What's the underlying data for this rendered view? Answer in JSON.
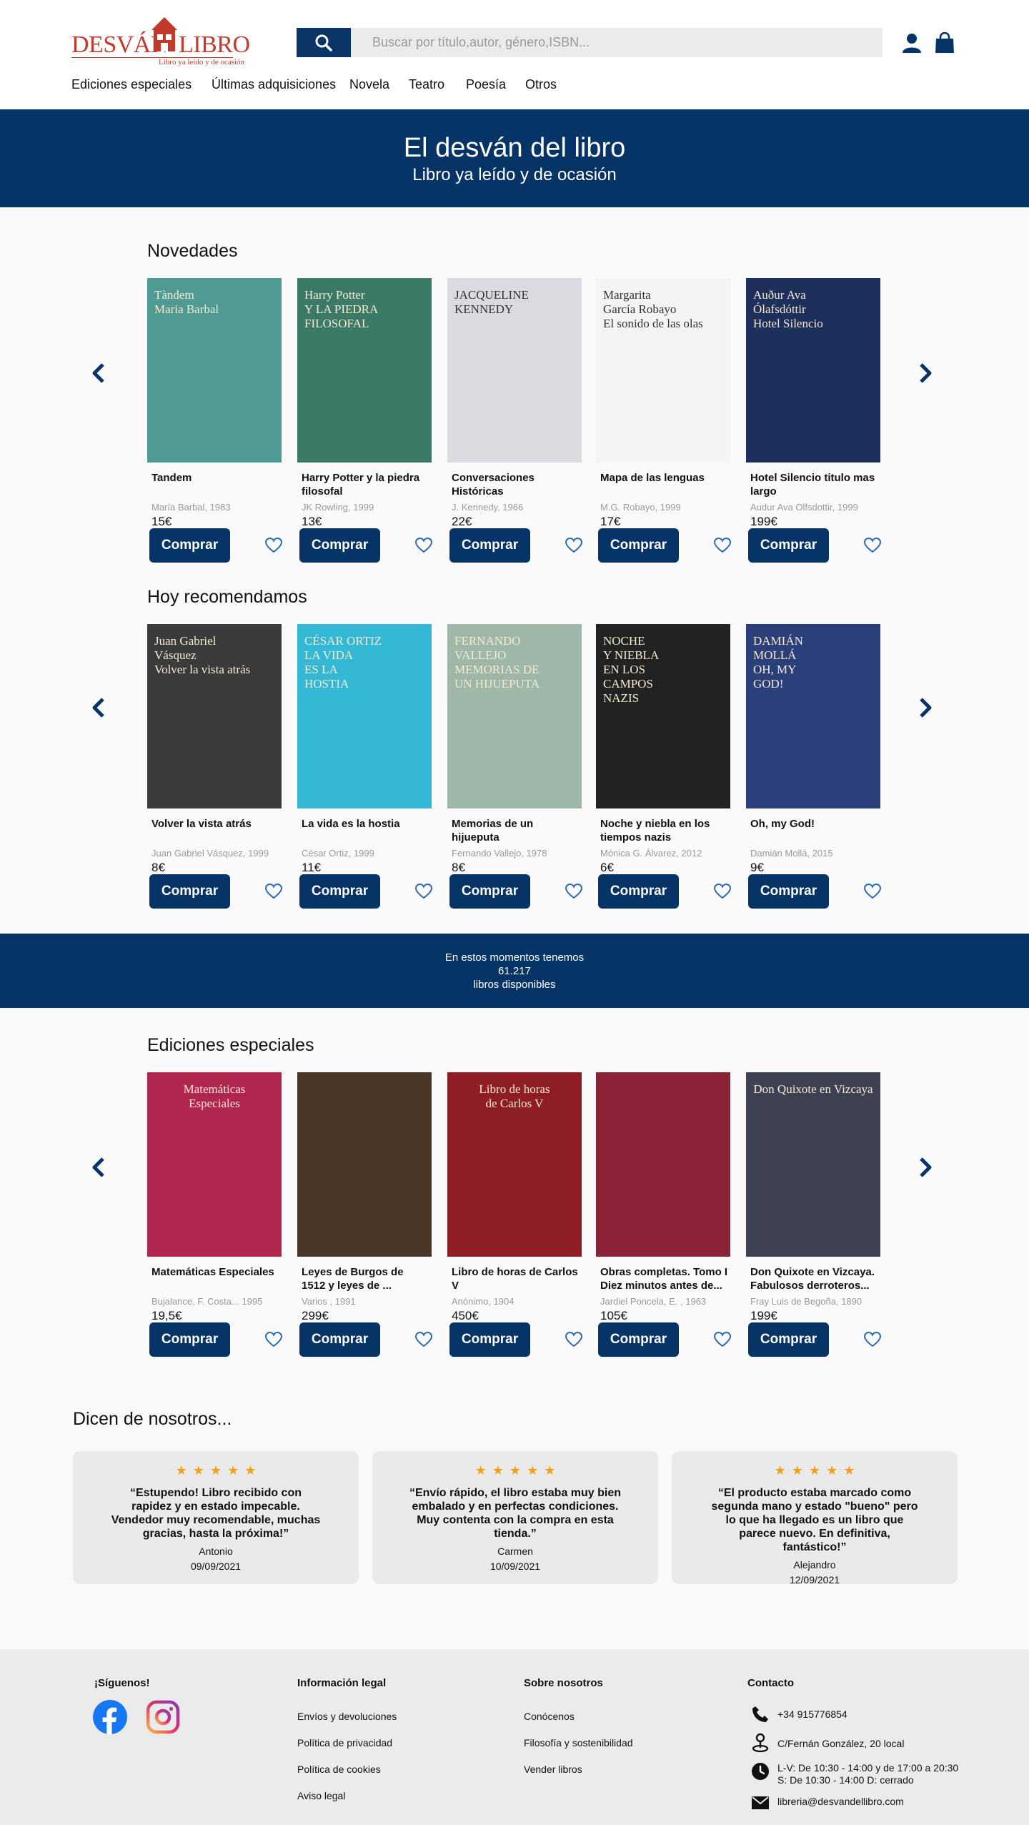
{
  "brand": {
    "name_left": "DESVÁN",
    "name_right": "LIBRO",
    "tagline": "Libro ya leído y de ocasión",
    "primary_color": "#073467",
    "logo_color": "#c23a2b"
  },
  "search": {
    "placeholder": "Buscar por título,autor, género,ISBN...",
    "value": ""
  },
  "nav": [
    "Ediciones especiales",
    "Últimas adquisiciones",
    "Novela",
    "Teatro",
    "Poesía",
    "Otros"
  ],
  "hero": {
    "title": "El desván del libro",
    "subtitle": "Libro ya leído y de ocasión"
  },
  "buy_label": "Comprar",
  "sections": [
    {
      "title": "Novedades",
      "books": [
        {
          "title": "Tandem",
          "meta": "María Barbal, 1983",
          "price": "15€",
          "cover_text": "Tàndem\nMaria Barbal",
          "cover_color": "#4f9a93"
        },
        {
          "title": "Harry Potter y la piedra filosofal",
          "meta": "JK Rowling, 1999",
          "price": "13€",
          "cover_text": "Harry Potter\nY LA PIEDRA FILOSOFAL",
          "cover_color": "#3a7a66"
        },
        {
          "title": "Conversaciones Históricas",
          "meta": "J. Kennedy, 1966",
          "price": "22€",
          "cover_text": "JACQUELINE\nKENNEDY",
          "cover_color": "#d9dbe0"
        },
        {
          "title": "Mapa de las lenguas",
          "meta": "M.G. Robayo, 1999",
          "price": "17€",
          "cover_text": "Margarita\nGarcía Robayo\nEl sonido de las olas",
          "cover_color": "#f4f4f2"
        },
        {
          "title": "Hotel Silencio titulo mas largo",
          "meta": "Audur Ava Olfsdottir, 1999",
          "price": "199€",
          "cover_text": "Auður Ava\nÓlafsdóttir\nHotel Silencio",
          "cover_color": "#1d2f5a"
        }
      ]
    },
    {
      "title": "Hoy recomendamos",
      "books": [
        {
          "title": "Volver la vista atrás",
          "meta": "Juan Gabriel Vásquez, 1999",
          "price": "8€",
          "cover_text": "Juan Gabriel\nVásquez\nVolver la vista atrás",
          "cover_color": "#3b3b3b"
        },
        {
          "title": "La vida es la hostia",
          "meta": "César Ortiz, 1999",
          "price": "11€",
          "cover_text": "CÉSAR ORTIZ\nLA VIDA\nES LA\nHOSTIA",
          "cover_color": "#33b9d6"
        },
        {
          "title": "Memorias de un hijueputa",
          "meta": "Fernando Vallejo, 1978",
          "price": "8€",
          "cover_text": "FERNANDO\nVALLEJO\nMEMORIAS DE\nUN HIJUEPUTA",
          "cover_color": "#9fb7a8"
        },
        {
          "title": "Noche y niebla en los tiempos nazis",
          "meta": "Mónica G. Álvarez, 2012",
          "price": "6€",
          "cover_text": "NOCHE\nY NIEBLA\nEN LOS\nCAMPOS\nNAZIS",
          "cover_color": "#222222"
        },
        {
          "title": "Oh, my God!",
          "meta": "Damián Mollá, 2015",
          "price": "9€",
          "cover_text": "DAMIÁN\nMOLLÁ\nOH, MY\nGOD!",
          "cover_color": "#2b3f7a"
        }
      ]
    },
    {
      "title": "Ediciones especiales",
      "books": [
        {
          "title": "Matemáticas Especiales",
          "meta": "Bujalance, F. Costa... 1995",
          "price": "19,5€",
          "cover_text": "Matemáticas\nEspeciales",
          "cover_color": "#b1264f"
        },
        {
          "title": "Leyes de Burgos de 1512 y leyes de ...",
          "meta": "Varios , 1991",
          "price": "299€",
          "cover_text": "",
          "cover_color": "#4a3626"
        },
        {
          "title": "Libro de horas de Carlos V",
          "meta": "Anónimo, 1904",
          "price": "450€",
          "cover_text": "Libro de horas\nde Carlos V",
          "cover_color": "#8e1d25"
        },
        {
          "title": "Obras completas. Tomo I Diez minutos antes de...",
          "meta": "Jardiel Poncela, E. , 1963",
          "price": "105€",
          "cover_text": "",
          "cover_color": "#8a2238"
        },
        {
          "title": "Don Quixote en Vizcaya. Fabulosos derroteros...",
          "meta": "Fray Luis de Begoña, 1890",
          "price": "199€",
          "cover_text": "Don Quixote en Vizcaya",
          "cover_color": "#3e4152"
        }
      ]
    }
  ],
  "stats": {
    "line1": "En estos momentos tenemos",
    "count": "61.217",
    "line2": "libros disponibles"
  },
  "reviews_title": "Dicen de nosotros...",
  "reviews": [
    {
      "stars": "★★★★★",
      "rating": 5,
      "quote": "“Estupendo! Libro recibido con rapidez y en estado impecable. Vendedor muy recomendable, muchas gracias, hasta la próxima!”",
      "author": "Antonio",
      "date": "09/09/2021"
    },
    {
      "stars": "★★★★★",
      "rating": 5,
      "quote": "“Envío rápido, el libro estaba muy bien embalado y en perfectas condiciones. Muy contenta con la compra en esta tienda.”",
      "author": "Carmen",
      "date": "10/09/2021"
    },
    {
      "stars": "★★★★★",
      "rating": 5,
      "quote": "“El producto estaba marcado como segunda mano y estado \"bueno\" pero lo que ha llegado es un libro que parece nuevo. En definitiva, fantástico!”",
      "author": "Alejandro",
      "date": "12/09/2021"
    }
  ],
  "footer": {
    "follow": {
      "title": "¡Síguenos!",
      "icons": [
        "facebook-icon",
        "instagram-icon"
      ]
    },
    "legal": {
      "title": "Información legal",
      "links": [
        "Envíos y devoluciones",
        "Política de privacidad",
        "Política de cookies",
        "Aviso legal"
      ]
    },
    "about": {
      "title": "Sobre nosotros",
      "links": [
        "Conócenos",
        "Filosofía y sostenibilidad",
        "Vender libros"
      ]
    },
    "contact": {
      "title": "Contacto",
      "phone": "+34 915776854",
      "address": "C/Fernán González, 20 local",
      "hours_1": "L-V: De 10:30 - 14:00 y de 17:00 a 20:30",
      "hours_2": "S: De 10:30 - 14:00 D: cerrado",
      "email": "libreria@desvandellibro.com"
    }
  }
}
